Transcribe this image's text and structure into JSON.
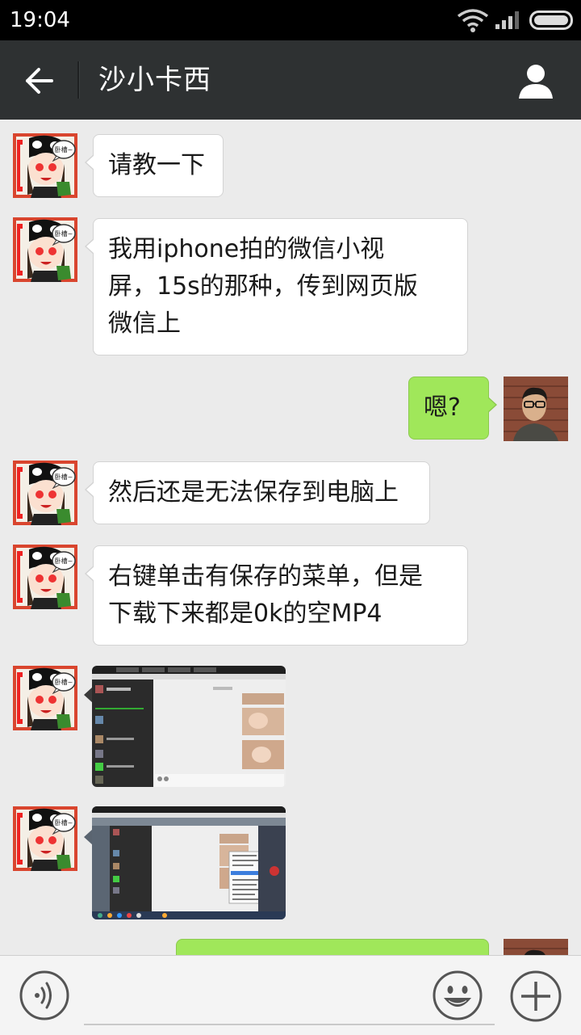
{
  "status_bar": {
    "time": "19:04",
    "icons": [
      "wifi-icon",
      "signal-icon",
      "battery-icon"
    ]
  },
  "header": {
    "title": "沙小卡西",
    "back_icon": "arrow-left-icon",
    "contact_icon": "person-icon"
  },
  "messages": [
    {
      "sender": "other",
      "type": "text",
      "lines": [
        "请教一下"
      ]
    },
    {
      "sender": "other",
      "type": "text",
      "lines": [
        "我用iphone拍的微信小视",
        "屏，15s的那种，传到网页版",
        "微信上"
      ]
    },
    {
      "sender": "me",
      "type": "text",
      "lines": [
        "嗯?"
      ]
    },
    {
      "sender": "other",
      "type": "text",
      "lines": [
        "然后还是无法保存到电脑上"
      ]
    },
    {
      "sender": "other",
      "type": "text",
      "lines": [
        "右键单击有保存的菜单，但是",
        "下载下来都是0k的空MP4"
      ]
    },
    {
      "sender": "other",
      "type": "image",
      "content": "screenshot-of-web-wechat"
    },
    {
      "sender": "other",
      "type": "image",
      "content": "screenshot-of-web-wechat-context-menu"
    },
    {
      "sender": "me",
      "type": "text",
      "lines": [
        ""
      ]
    }
  ],
  "avatar_sticker_text": "卧槽~",
  "input_bar": {
    "placeholder": "",
    "voice_icon": "voice-icon",
    "emoji_icon": "emoji-icon",
    "plus_icon": "plus-icon"
  },
  "colors": {
    "titlebar": "#2e3132",
    "background": "#ebebeb",
    "my_bubble": "#a0e75a",
    "their_bubble": "#ffffff"
  }
}
